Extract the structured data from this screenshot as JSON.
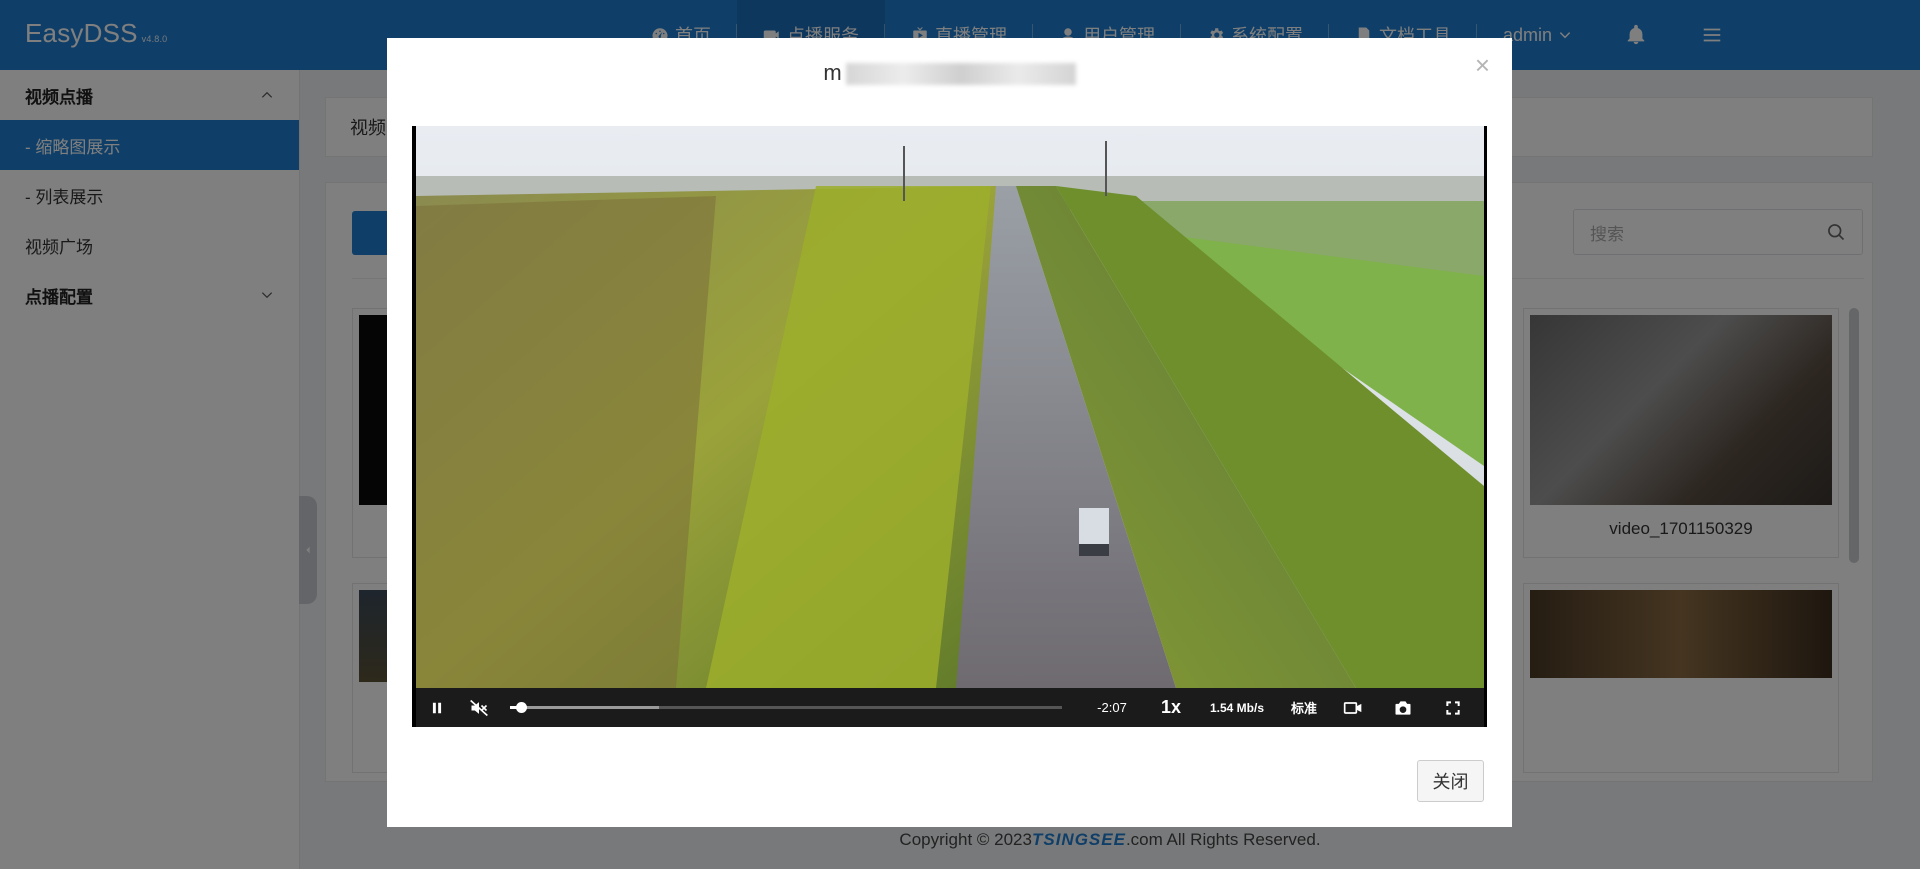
{
  "header": {
    "brand": "EasyDSS",
    "version": "v4.8.0",
    "nav": [
      {
        "label": "首页",
        "icon": "dashboard-icon"
      },
      {
        "label": "点播服务",
        "icon": "video-camera-icon"
      },
      {
        "label": "直播管理",
        "icon": "live-icon"
      },
      {
        "label": "用户管理",
        "icon": "user-icon"
      },
      {
        "label": "系统配置",
        "icon": "gear-icon"
      },
      {
        "label": "文档工具",
        "icon": "document-icon"
      }
    ],
    "user": "admin"
  },
  "sidebar": {
    "groups": [
      {
        "label": "视频点播",
        "expanded": true,
        "items": [
          "- 缩略图展示",
          "- 列表展示",
          "视频广场"
        ]
      },
      {
        "label": "点播配置",
        "expanded": false,
        "items": []
      }
    ]
  },
  "main": {
    "breadcrumb": "视频",
    "search_placeholder": "搜索",
    "cards": [
      {
        "label": "video_1701150329"
      }
    ]
  },
  "footer": {
    "prefix": "Copyright © 2023 ",
    "brand": "TSINGSEE",
    "suffix": ".com All Rights Reserved."
  },
  "modal": {
    "title_visible": "m",
    "close_symbol": "×",
    "close_button": "关闭",
    "player": {
      "time_remaining": "-2:07",
      "speed": "1x",
      "bitrate": "1.54 Mb/s",
      "quality": "标准",
      "progress_played": 0.02,
      "progress_buffered": 0.27
    }
  },
  "colors": {
    "accent": "#1f7ed0",
    "active_nav": "#1a6fba",
    "overlay": "rgba(0,0,0,0.5)"
  }
}
